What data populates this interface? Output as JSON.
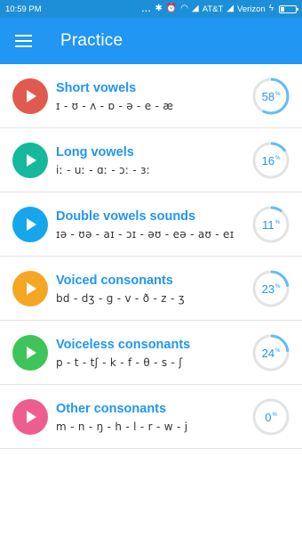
{
  "status_bar": {
    "time": "10:59 PM",
    "dots": "...",
    "carrier_1": "AT&T",
    "carrier_2": "Verizon",
    "icons": [
      "bluetooth-icon",
      "alarm-icon",
      "wifi-icon",
      "signal-icon",
      "signal-icon",
      "battery-icon"
    ]
  },
  "app_bar": {
    "title": "Practice",
    "menu_icon": "menu-icon"
  },
  "items": [
    {
      "title": "Short vowels",
      "symbols": "ɪ - ʊ - ʌ - ɒ - ə - e - æ",
      "percent": 58,
      "percent_label": "58",
      "play_color": "#e05a4f"
    },
    {
      "title": "Long vowels",
      "symbols": "iː - uː - ɑː - ɔː - ɜː",
      "percent": 16,
      "percent_label": "16",
      "play_color": "#15b89a"
    },
    {
      "title": "Double vowels sounds",
      "symbols": "ɪə - ʊə - aɪ - ɔɪ - əʊ - eə - aʊ - eɪ",
      "percent": 11,
      "percent_label": "11",
      "play_color": "#16a6ec"
    },
    {
      "title": "Voiced consonants",
      "symbols": "bd - dʒ - g - v - ð - z - ʒ",
      "percent": 23,
      "percent_label": "23",
      "play_color": "#f5a623"
    },
    {
      "title": "Voiceless consonants",
      "symbols": "p - t - tʃ - k - f - θ - s - ʃ",
      "percent": 24,
      "percent_label": "24",
      "play_color": "#3ec45a"
    },
    {
      "title": "Other consonants",
      "symbols": "m - n - ŋ - h - l - r - w - j",
      "percent": 0,
      "percent_label": "0",
      "play_color": "#ee5d90"
    }
  ],
  "percent_sign": "%",
  "colors": {
    "accent": "#2196f3",
    "status_bar": "#1d8fd8",
    "ring_track": "#e3e3e3",
    "ring_fill": "#64bdf3"
  }
}
